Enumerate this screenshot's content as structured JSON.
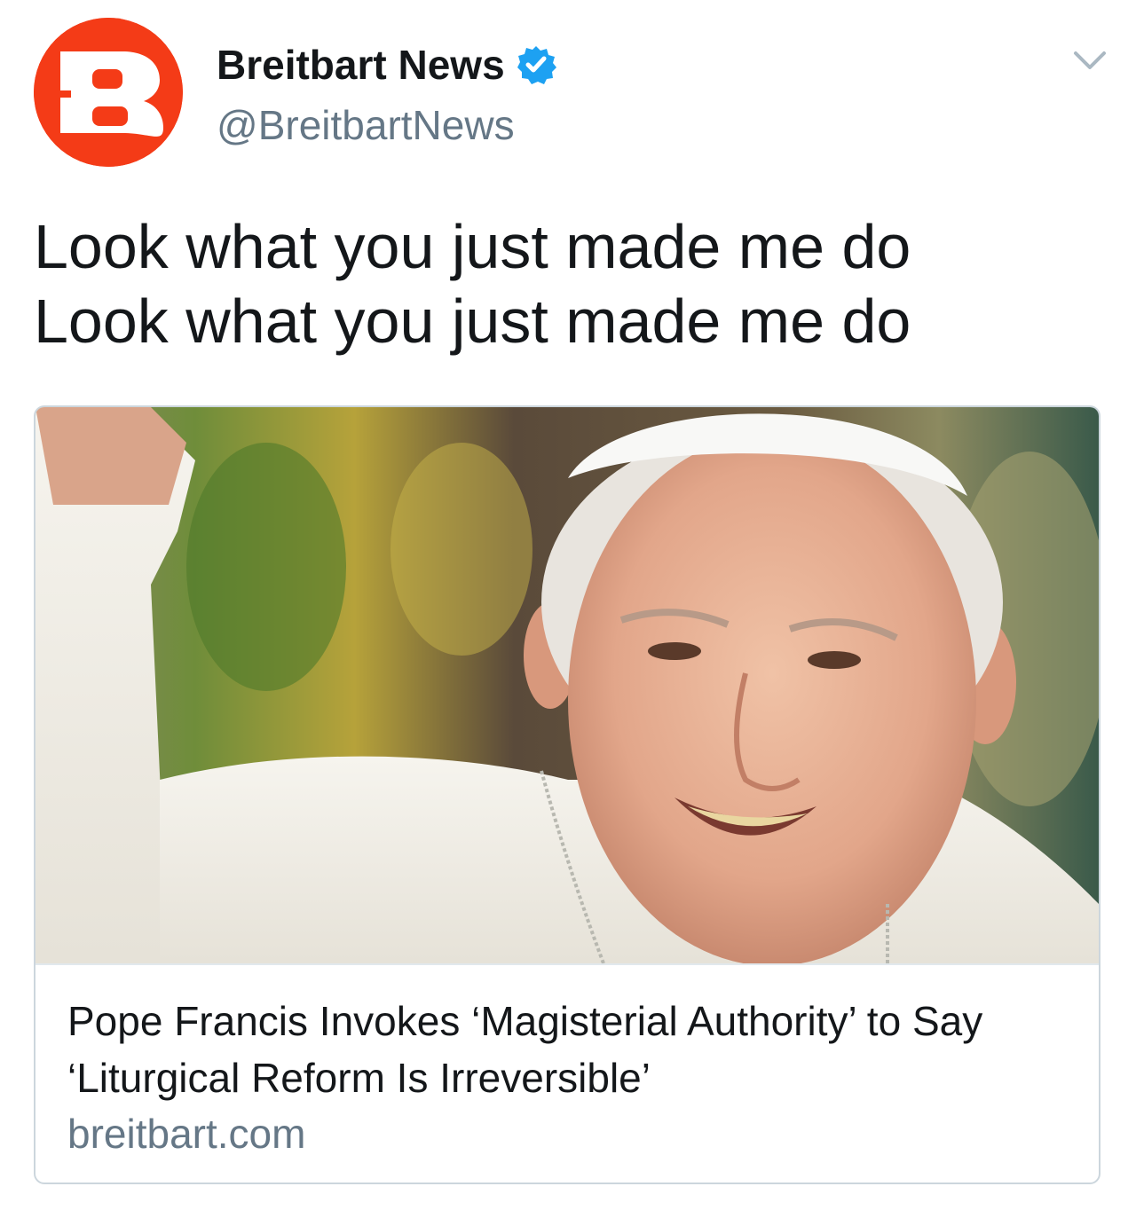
{
  "author": {
    "name": "Breitbart News",
    "handle": "@BreitbartNews",
    "verified": true,
    "avatar_letter": "B",
    "avatar_color": "#f43b17"
  },
  "tweet": {
    "lines": [
      "Look what you just made me do",
      "Look what you just made me do"
    ]
  },
  "card": {
    "image_icon": "pope-francis-photo",
    "title_lines": [
      "Pope Francis Invokes ‘Magisterial Authority’ to Say",
      "‘Liturgical Reform Is Irreversible’"
    ],
    "domain": "breitbart.com"
  },
  "icons": {
    "verified": "verified-badge-icon",
    "menu": "chevron-down-icon"
  },
  "colors": {
    "verified_blue": "#1da1f2",
    "text_primary": "#14171a",
    "text_secondary": "#657786",
    "border": "#ccd6dd"
  }
}
